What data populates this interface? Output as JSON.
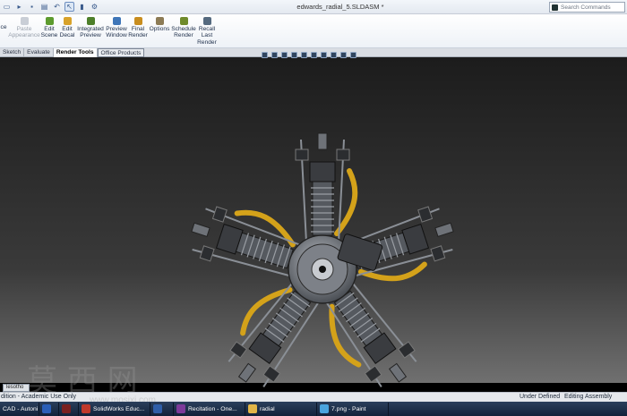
{
  "titlebar": {
    "doc_title": "edwards_radial_5.SLDASM *",
    "search_placeholder": "Search Commands",
    "quick_access_icons": [
      "new-icon",
      "open-icon",
      "save-icon",
      "print-icon",
      "undo-icon",
      "select-icon",
      "rebuild-icon",
      "options-icon"
    ]
  },
  "ribbon": {
    "items": [
      {
        "label": "Paste\nAppearance",
        "icon": "paste-appearance-icon",
        "dim": true
      },
      {
        "label": "Edit\nScene",
        "icon": "scene-icon"
      },
      {
        "label": "Edit\nDecal",
        "icon": "decal-icon"
      },
      {
        "label": "Integrated\nPreview",
        "icon": "integrated-preview-icon"
      },
      {
        "label": "Preview\nWindow",
        "icon": "preview-window-icon"
      },
      {
        "label": "Final\nRender",
        "icon": "final-render-icon"
      },
      {
        "label": "Options",
        "icon": "options-icon"
      },
      {
        "label": "Schedule\nRender",
        "icon": "schedule-icon"
      },
      {
        "label": "Recall\nLast\nRender",
        "icon": "recall-icon"
      }
    ],
    "clipped_left": "ce"
  },
  "tabs": [
    "Sketch",
    "Evaluate",
    "Render Tools",
    "Office Products"
  ],
  "model_tab": "lesotho",
  "statusbar": {
    "left": "dition - Academic Use Only",
    "under_defined": "Under Defined",
    "editing": "Editing Assembly"
  },
  "taskbar": {
    "items": [
      {
        "label": "CAD - Autoni",
        "color": "#8e9bb0"
      },
      {
        "label": "",
        "color": "#2b5fb8"
      },
      {
        "label": "",
        "color": "#7a2020"
      },
      {
        "label": "SolidWorks Educ...",
        "color": "#c0392b"
      },
      {
        "label": "",
        "color": "#2f5ea8"
      },
      {
        "label": "Recitation - One...",
        "color": "#7d3a9a"
      },
      {
        "label": "radial",
        "color": "#e2b547"
      },
      {
        "label": "7.png - Paint",
        "color": "#4aa4de"
      }
    ]
  },
  "watermark": {
    "chars": "莫 西 网",
    "url": "www.mosixi.com"
  },
  "colors": {
    "viewport_top": "#1c1c1c",
    "viewport_bottom": "#707070",
    "tube_gold": "#d4a21a",
    "metal": "#8a8f96"
  }
}
